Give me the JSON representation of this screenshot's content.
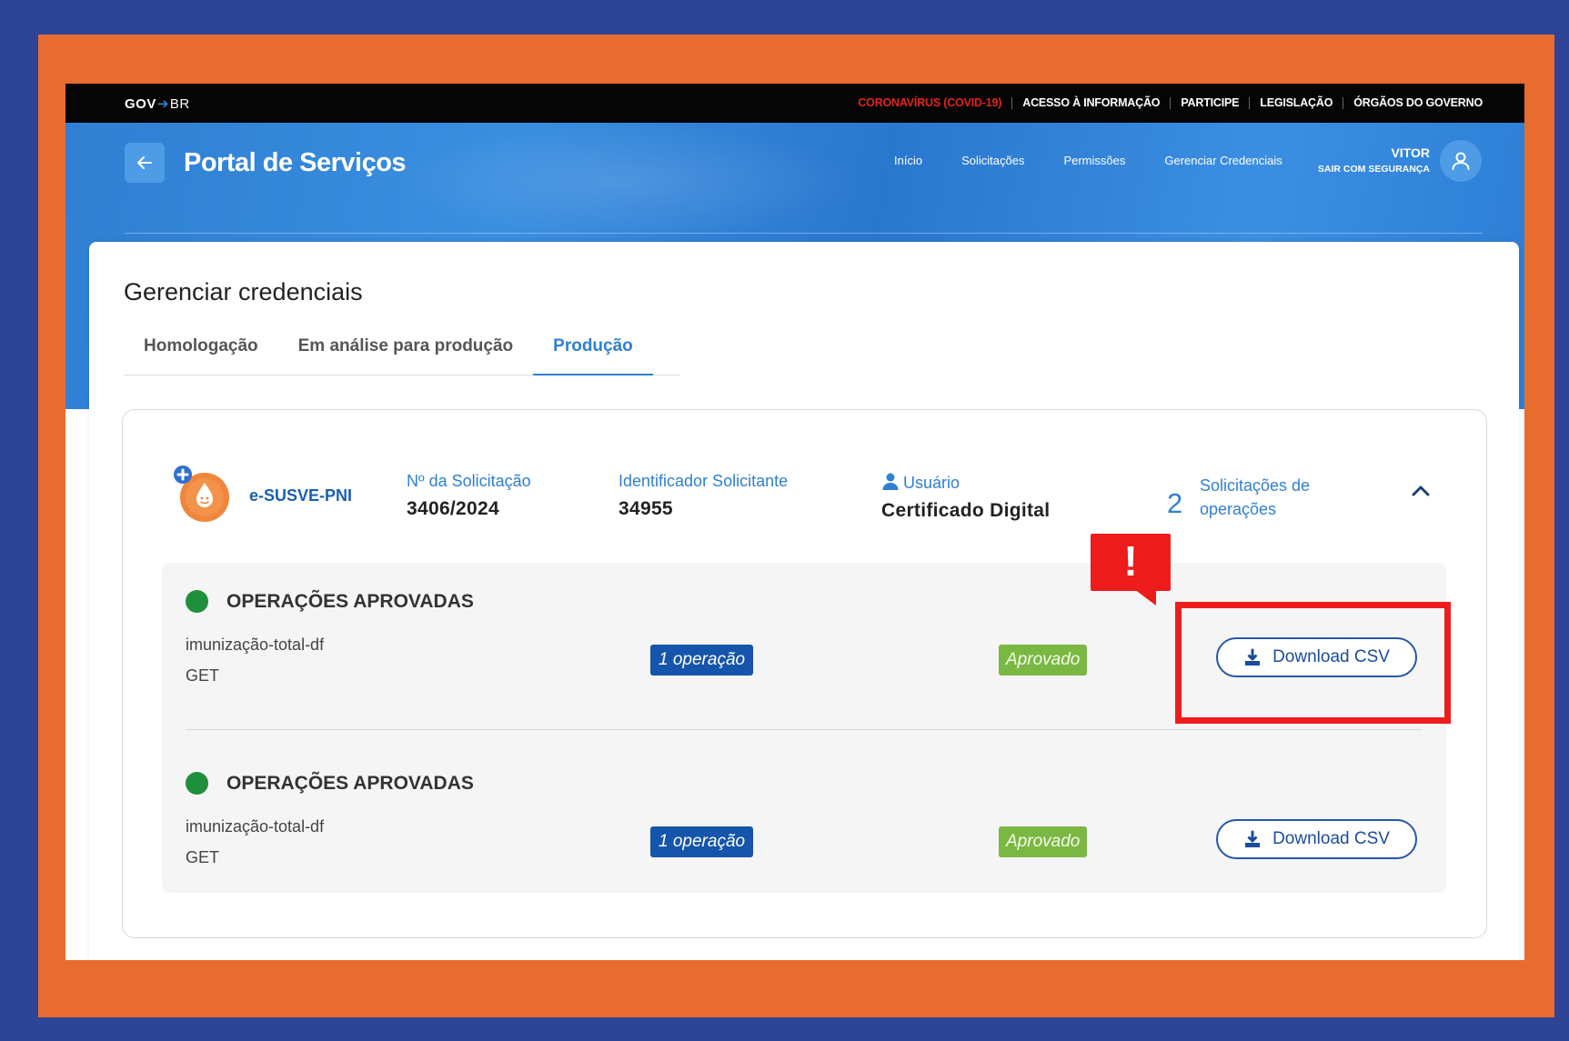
{
  "govbar": {
    "logo_gov": "GOV",
    "logo_br": "BR",
    "links": [
      "CORONAVÍRUS (COVID-19)",
      "ACESSO À INFORMAÇÃO",
      "PARTICIPE",
      "LEGISLAÇÃO",
      "ÓRGÃOS DO GOVERNO"
    ]
  },
  "header": {
    "title": "Portal de Serviços",
    "nav": [
      "Início",
      "Solicitações",
      "Permissões",
      "Gerenciar Credenciais"
    ],
    "user_name": "VITOR",
    "logout": "SAIR COM SEGURANÇA"
  },
  "page": {
    "title": "Gerenciar credenciais",
    "tabs": [
      "Homologação",
      "Em análise para produção",
      "Produção"
    ],
    "active_tab": "Produção"
  },
  "request": {
    "app_name": "e-SUSVE-PNI",
    "solicitacao_label": "Nº da Solicitação",
    "solicitacao_value": "3406/2024",
    "identificador_label": "Identificador Solicitante",
    "identificador_value": "34955",
    "usuario_label": "Usuário",
    "usuario_value": "Certificado Digital",
    "ops_count": "2",
    "ops_label_1": "Solicitações de",
    "ops_label_2": "operações"
  },
  "operations": [
    {
      "title": "OPERAÇÕES APROVADAS",
      "name": "imunização-total-df",
      "method": "GET",
      "count": "1 operação",
      "status": "Aprovado",
      "download": "Download CSV"
    },
    {
      "title": "OPERAÇÕES APROVADAS",
      "name": "imunização-total-df",
      "method": "GET",
      "count": "1 operação",
      "status": "Aprovado",
      "download": "Download CSV"
    }
  ],
  "annotation": {
    "alert_symbol": "!"
  },
  "colors": {
    "primary_blue": "#2f7fd3",
    "dark_blue": "#1555ab",
    "approved_green": "#7bb843",
    "status_dot": "#1e8f3a",
    "highlight_red": "#ee1c1c",
    "frame_orange": "#e86c30",
    "frame_navy": "#2e4496"
  }
}
